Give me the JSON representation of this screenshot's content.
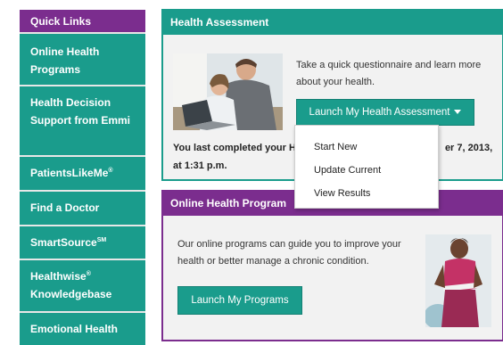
{
  "sidebar": {
    "header": "Quick Links",
    "items": [
      {
        "label": "Online Health Programs"
      },
      {
        "label": "Health Decision Support from Emmi"
      },
      {
        "label": "PatientsLikeMe",
        "mark": "®"
      },
      {
        "label": "Find a Doctor"
      },
      {
        "label": "SmartSource",
        "mark": "SM"
      },
      {
        "label": "Healthwise",
        "mark": "®",
        "label2": "Knowledgebase"
      },
      {
        "label": "Emotional Health"
      }
    ]
  },
  "health_assessment": {
    "title": "Health Assessment",
    "description": "Take a quick questionnaire and learn more about your health.",
    "launch_button": "Launch My Health Assessment",
    "last_completed": "You last completed your H",
    "last_completed_tail": "er 7, 2013,",
    "last_completed_time": "at 1:31 p.m."
  },
  "dropdown": {
    "items": [
      "Start New",
      "Update Current",
      "View Results"
    ]
  },
  "online_programs": {
    "title": "Online Health Program",
    "description": "Our online programs can guide you to improve your health or better manage a chronic condition.",
    "launch_button": "Launch My Programs"
  },
  "colors": {
    "teal": "#1a9c8c",
    "purple": "#7b2d8e",
    "panel_bg": "#f2f2f2"
  }
}
